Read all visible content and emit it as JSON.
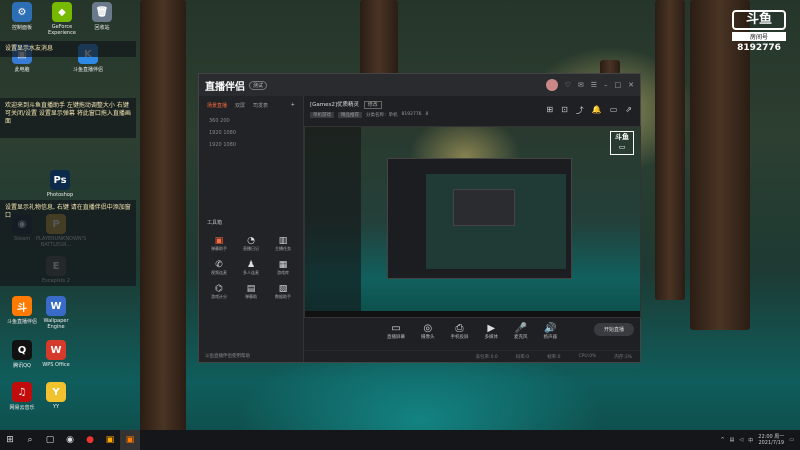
{
  "desktop": {
    "icons": [
      {
        "label": "控制面板",
        "glyph": "⚙",
        "color": "#2d6fb5"
      },
      {
        "label": "GeForce Experience",
        "glyph": "◆",
        "color": "#76b900"
      },
      {
        "label": "回收站",
        "glyph": "🗑",
        "color": "#6a7a8a"
      },
      {
        "label": "此电脑",
        "glyph": "▣",
        "color": "#3a7bd5"
      },
      {
        "label": "斗鱼直播伴侣",
        "glyph": "K",
        "color": "#2e8ae6"
      },
      {
        "label": "Photoshop",
        "glyph": "Ps",
        "color": "#0c2a4a"
      },
      {
        "label": "Steam",
        "glyph": "◉",
        "color": "#1b2838"
      },
      {
        "label": "PLAYERUNKNOWN'S BATTLEGR...",
        "glyph": "P",
        "color": "#c59a3a"
      },
      {
        "label": "Escapists 2",
        "glyph": "E",
        "color": "#555"
      },
      {
        "label": "Wallpaper Engine",
        "glyph": "W",
        "color": "#3b6bc8"
      },
      {
        "label": "斗鱼直播伴侣",
        "glyph": "斗",
        "color": "#ff7a00"
      },
      {
        "label": "腾讯QQ",
        "glyph": "Q",
        "color": "#111"
      },
      {
        "label": "WPS Office",
        "glyph": "W",
        "color": "#d63a2a"
      },
      {
        "label": "网易云音乐",
        "glyph": "♫",
        "color": "#c20c0c"
      },
      {
        "label": "YY",
        "glyph": "Y",
        "color": "#f2c12e"
      }
    ],
    "notices": [
      "设置显示水友消息",
      "欢迎来到斗鱼直播助手 左键拖动调整大小 右键可关闭/设置 设置显示弹幕 将此窗口拖入直播画面",
      "设置显示礼物信息, 右键 请在直播伴侣中添加窗口"
    ]
  },
  "watermark": {
    "logo": "斗鱼",
    "sub": "房间号",
    "room": "8192776"
  },
  "app": {
    "brand": "直播伴侣",
    "version": "测试",
    "side_tabs": [
      "场景直播",
      "双屏",
      "司发表"
    ],
    "scenes": [
      "360 200",
      "1920 1080",
      "1920 1080"
    ],
    "tools_title": "工具箱",
    "tools": [
      {
        "label": "弹幕助手",
        "glyph": "▣",
        "hot": true
      },
      {
        "label": "直播日记",
        "glyph": "◔",
        "hot": false
      },
      {
        "label": "主播任务",
        "glyph": "▥",
        "hot": false
      },
      {
        "label": "视频连麦",
        "glyph": "✆",
        "hot": false
      },
      {
        "label": "多人连麦",
        "glyph": "♟",
        "hot": false
      },
      {
        "label": "游戏库",
        "glyph": "▦",
        "hot": false
      },
      {
        "label": "游戏计分",
        "glyph": "⌬",
        "hot": false
      },
      {
        "label": "弹幕助",
        "glyph": "▤",
        "hot": false
      },
      {
        "label": "数据助手",
        "glyph": "▧",
        "hot": false
      }
    ],
    "side_footer": "斗鱼直播伴侣使用帮助",
    "room_title": "[Games2]优质精灵",
    "room_badge": "修改",
    "room_tags": [
      "单机游戏",
      "精品推荐",
      "分类名称：单机",
      "8192776",
      "8"
    ],
    "controls": [
      {
        "label": "直播屏幕",
        "glyph": "▭"
      },
      {
        "label": "摄像头",
        "glyph": "◎"
      },
      {
        "label": "手机投屏",
        "glyph": "⎙"
      },
      {
        "label": "多媒体",
        "glyph": "▶"
      },
      {
        "label": "麦克风",
        "glyph": "🎤"
      },
      {
        "label": "扬声器",
        "glyph": "🔊"
      }
    ],
    "live_button": "开始直播",
    "status": [
      "丢包率:0.0",
      "码率:0",
      "帧率:0",
      "CPU:0%",
      "内存:3%"
    ]
  },
  "taskbar": {
    "clock_time": "22:00 周一",
    "clock_date": "2021/7/19",
    "lang": "中"
  }
}
